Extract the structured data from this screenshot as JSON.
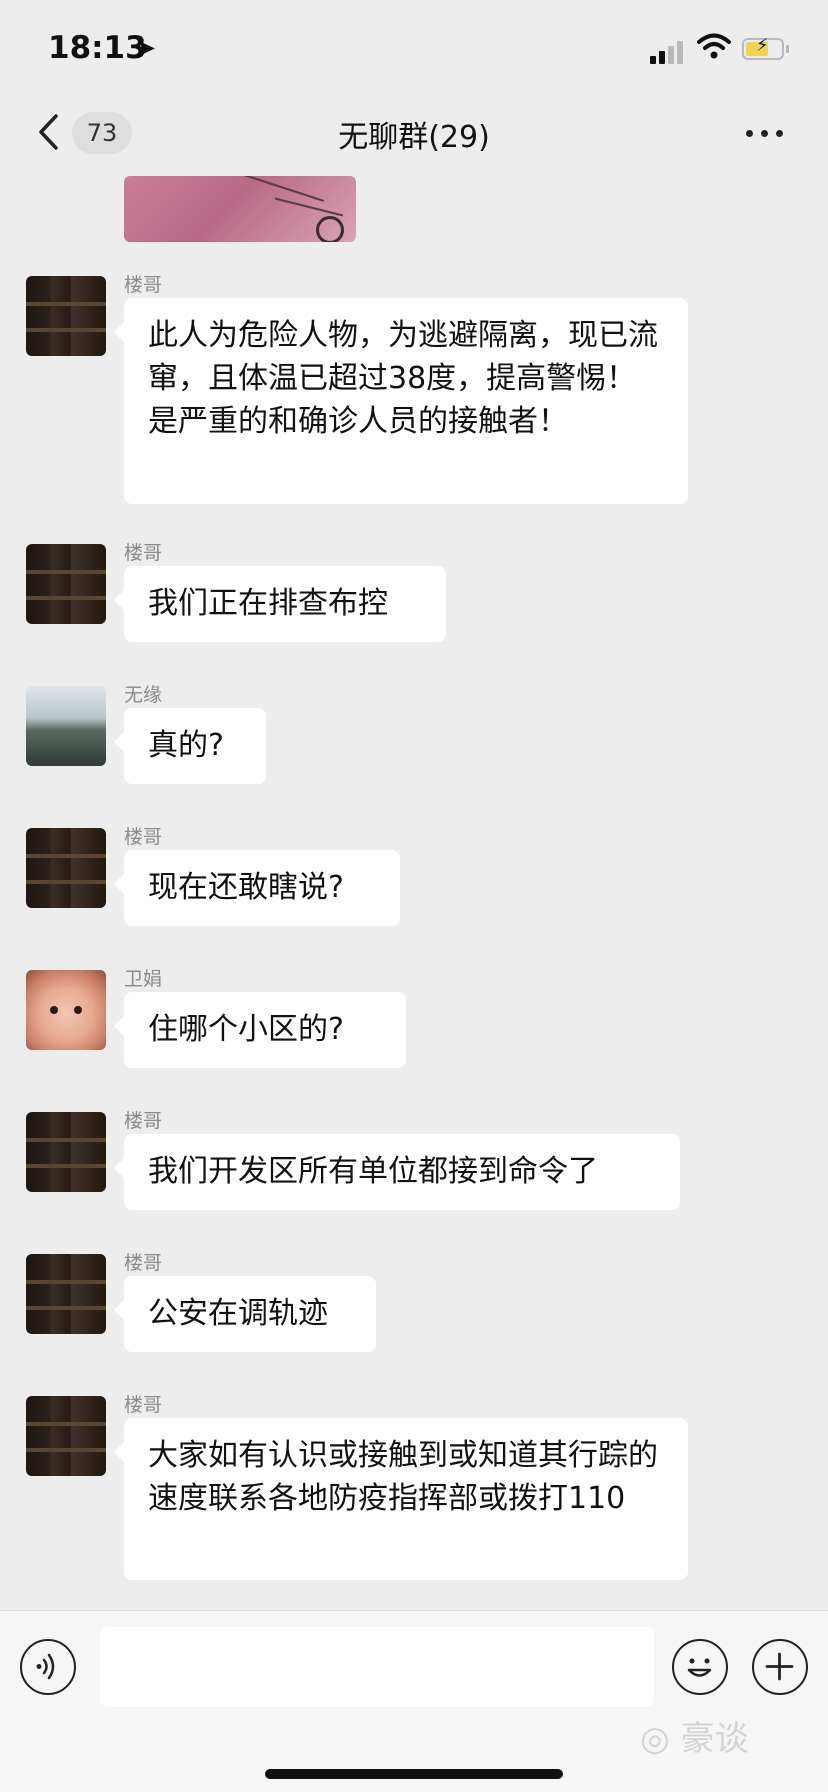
{
  "status_bar": {
    "time": "18:13",
    "location_icon": "location-arrow-icon",
    "battery_color": "#f1d35a"
  },
  "nav": {
    "back_icon": "chevron-left-icon",
    "unread_count": "73",
    "title": "无聊群(29)",
    "more_icon": "more-dots-icon"
  },
  "chat": {
    "messages": [
      {
        "sender": "楼哥",
        "text": "此人为危险人物，为逃避隔离，现已流窜，且体温已超过38度，提高警惕！是严重的和确诊人员的接触者！"
      },
      {
        "sender": "楼哥",
        "text": "我们正在排查布控"
      },
      {
        "sender": "无缘",
        "text": "真的?"
      },
      {
        "sender": "楼哥",
        "text": "现在还敢瞎说?"
      },
      {
        "sender": "卫娟",
        "text": "住哪个小区的?"
      },
      {
        "sender": "楼哥",
        "text": "我们开发区所有单位都接到命令了"
      },
      {
        "sender": "楼哥",
        "text": "公安在调轨迹"
      },
      {
        "sender": "楼哥",
        "text": "大家如有认识或接触到或知道其行踪的速度联系各地防疫指挥部或拨打110"
      }
    ]
  },
  "input_bar": {
    "voice_icon": "voice-icon",
    "emoji_icon": "emoji-icon",
    "plus_icon": "plus-icon",
    "watermark": "◎ 豪谈"
  }
}
